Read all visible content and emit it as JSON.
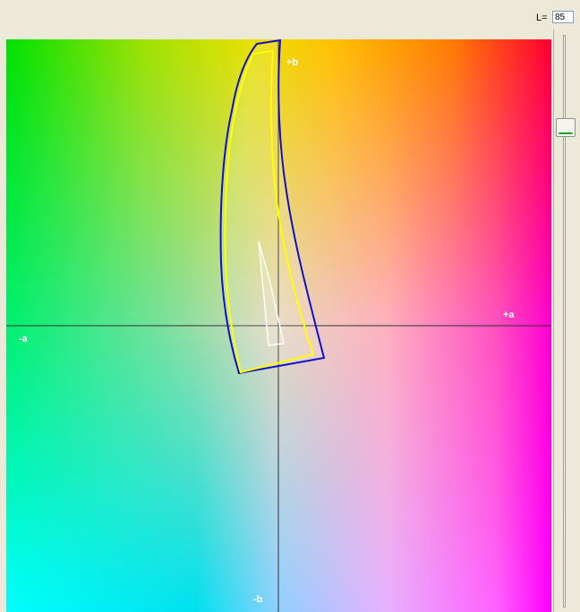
{
  "lightness": {
    "label": "L=",
    "value": "85",
    "fraction": 0.15
  },
  "axes": {
    "plus_a": "+a",
    "minus_a": "-a",
    "plus_b": "+b",
    "minus_b": "-b"
  },
  "colors": {
    "outer_gamut": "#1010c8",
    "inner_gamut": "#ffff00",
    "small_gamut": "#ffffff",
    "axis_line": "#303030"
  }
}
